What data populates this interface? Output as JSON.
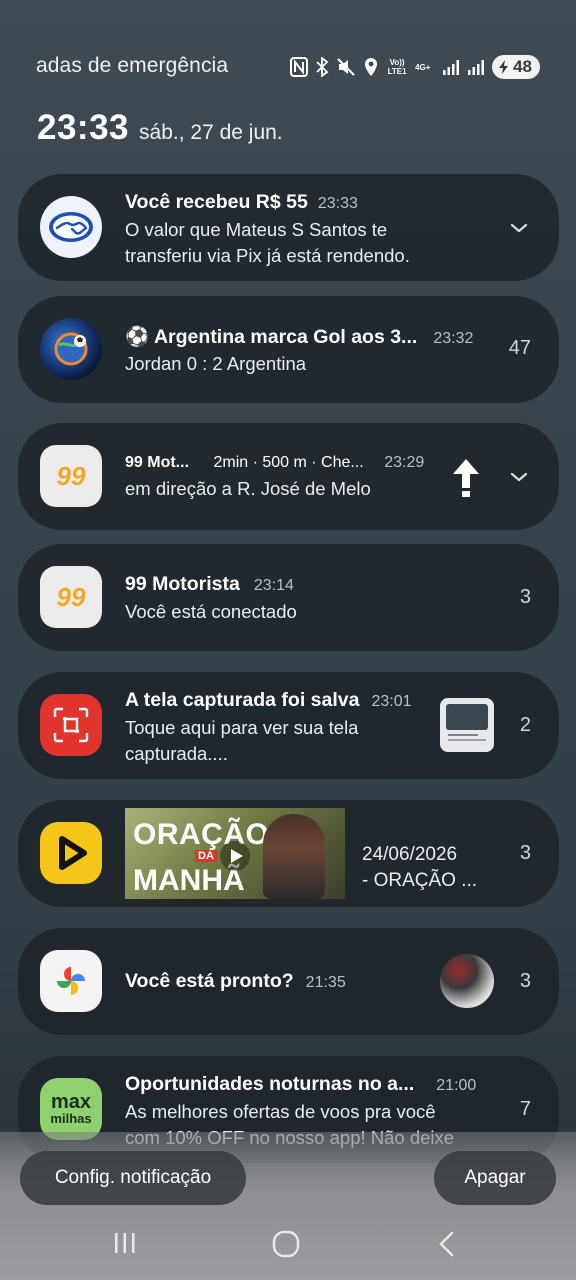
{
  "status_bar": {
    "emergency_text": "adas de emergência",
    "lte_label": "Vo)) LTE1",
    "net_label": "4G+",
    "battery": "48"
  },
  "lockscreen": {
    "time": "23:33",
    "date": "sáb., 27 de jun."
  },
  "notifications": [
    {
      "app": "mercado-pago",
      "title": "Você recebeu R$ 55",
      "time": "23:33",
      "body_line1": "O valor que Mateus S Santos te",
      "body_line2": "transferiu via Pix já está rendendo.",
      "count": ""
    },
    {
      "app": "sports",
      "title": "⚽ Argentina marca Gol aos 3...",
      "time": "23:32",
      "body_line1": "Jordan 0 : 2 Argentina",
      "count": "47"
    },
    {
      "app": "99-motorista",
      "icon_text": "99",
      "title": "99 Mot...",
      "subtitle": "2min · 500 m · Che...",
      "time": "23:29",
      "body_line1": "em direção a R. José de Melo",
      "count": ""
    },
    {
      "app": "99-motorista",
      "icon_text": "99",
      "title": "99 Motorista",
      "time": "23:14",
      "body_line1": "Você está conectado",
      "count": "3"
    },
    {
      "app": "screenshot",
      "title": "A tela capturada foi salva",
      "time": "23:01",
      "body_line1": "Toque aqui para ver sua tela",
      "body_line2": "capturada....",
      "count": "2"
    },
    {
      "app": "video",
      "thumb_text_top": "ORAÇÃO",
      "thumb_text_mid": "DA",
      "thumb_text_bottom": "MANHÃ",
      "body_line1": "24/06/2026",
      "body_line2": "- ORAÇÃO ...",
      "count": "3"
    },
    {
      "app": "google-photos",
      "title": "Você está pronto?",
      "time": "21:35",
      "count": "3"
    },
    {
      "app": "max-milhas",
      "icon_text_top": "max",
      "icon_text_bottom": "milhas",
      "title": "Oportunidades noturnas no a...",
      "time": "21:00",
      "body_line1": "As melhores ofertas de voos pra você",
      "body_line2": "com 10% OFF no nosso app! Não deixe",
      "count": "7"
    }
  ],
  "actions": {
    "settings_label": "Config. notificação",
    "clear_label": "Apagar"
  },
  "colors": {
    "accent_red": "#e0342c",
    "max_green": "#8fd16e",
    "video_yellow": "#f5c518"
  }
}
